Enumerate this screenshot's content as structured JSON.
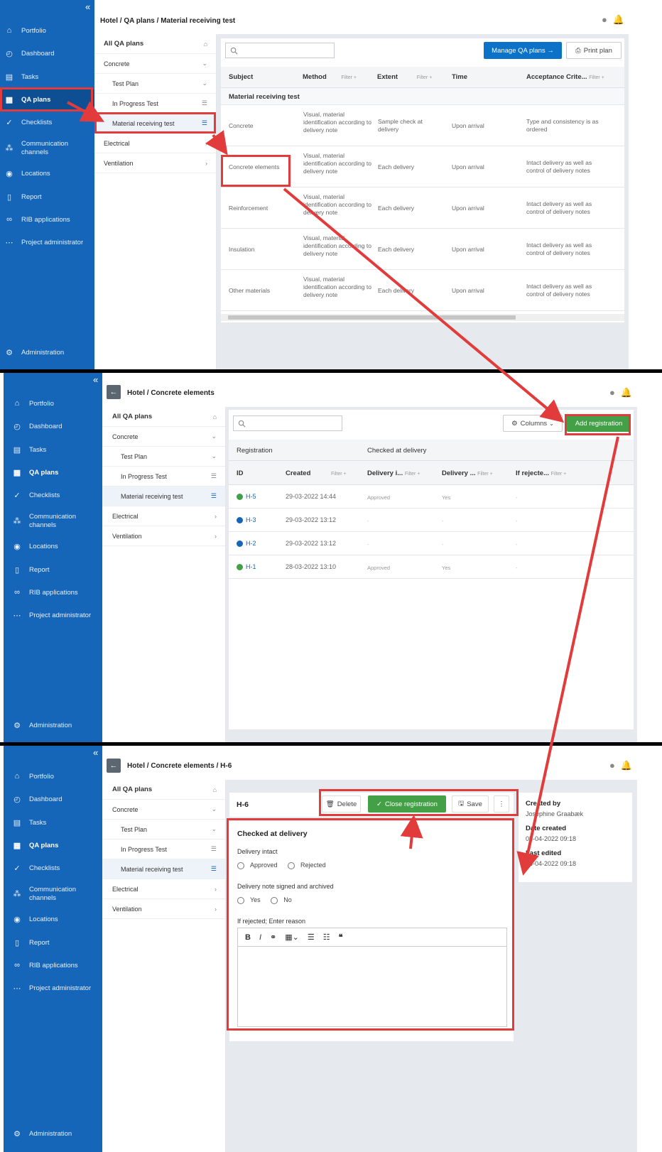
{
  "sidebar": {
    "items": [
      "Portfolio",
      "Dashboard",
      "Tasks",
      "QA plans",
      "Checklists",
      "Communication channels",
      "Locations",
      "Report",
      "RIB applications",
      "Project administrator"
    ],
    "admin": "Administration",
    "collapse": "«"
  },
  "nav": {
    "items": [
      "All QA plans",
      "Concrete",
      "Test Plan",
      "In Progress Test",
      "Material receiving test",
      "Electrical",
      "Ventilation"
    ]
  },
  "panel1": {
    "breadcrumb": "Hotel /  QA plans / Material receiving test",
    "manage_btn": "Manage QA plans →",
    "print_btn": "Print plan",
    "columns": [
      "Subject",
      "Method",
      "Extent",
      "Time",
      "Acceptance Crite..."
    ],
    "filter": "Filter +",
    "group": "Material receiving test",
    "rows": [
      {
        "subject": "Concrete",
        "method": "Visual, material identification according to delivery note",
        "extent": "Sample check at delivery",
        "time": "Upon arrival",
        "acceptance": "Type and consistency is as ordered"
      },
      {
        "subject": "Concrete elements",
        "method": "Visual, material identification according to delivery note",
        "extent": "Each delivery",
        "time": "Upon arrival",
        "acceptance": "Intact delivery as well as control of delivery notes"
      },
      {
        "subject": "Reinforcement",
        "method": "Visual, material identification according to delivery note",
        "extent": "Each delivery",
        "time": "Upon arrival",
        "acceptance": "Intact delivery as well as control of delivery notes"
      },
      {
        "subject": "Insulation",
        "method": "Visual, material identification according to delivery note",
        "extent": "Each delivery",
        "time": "Upon arrival",
        "acceptance": "Intact delivery as well as control of delivery notes"
      },
      {
        "subject": "Other materials",
        "method": "Visual, material identification according to delivery note",
        "extent": "Each delivery",
        "time": "Upon arrival",
        "acceptance": "Intact delivery as well as control of delivery notes"
      }
    ]
  },
  "panel2": {
    "breadcrumb": "Hotel / Concrete elements",
    "columns_btn": "Columns",
    "add_btn": "Add registration",
    "group_headers": [
      "Registration",
      "Checked at delivery"
    ],
    "columns": [
      "ID",
      "Created",
      "Delivery i...",
      "Delivery ...",
      "If rejecte..."
    ],
    "filter": "Filter +",
    "rows": [
      {
        "id": "H-5",
        "status": "green",
        "created": "29-03-2022 14:44",
        "intact": "Approved",
        "note": "Yes",
        "reason": "-"
      },
      {
        "id": "H-3",
        "status": "blue",
        "created": "29-03-2022 13:12",
        "intact": "-",
        "note": "-",
        "reason": "-"
      },
      {
        "id": "H-2",
        "status": "blue",
        "created": "29-03-2022 13:12",
        "intact": "-",
        "note": "-",
        "reason": "-"
      },
      {
        "id": "H-1",
        "status": "green",
        "created": "28-03-2022 13:10",
        "intact": "Approved",
        "note": "Yes",
        "reason": "-"
      }
    ]
  },
  "panel3": {
    "breadcrumb": "Hotel /  Concrete elements / H-6",
    "title": "H-6",
    "delete_btn": "Delete",
    "close_btn": "Close registration",
    "save_btn": "Save",
    "more": "⋮",
    "section": "Checked at delivery",
    "q1": "Delivery intact",
    "q1_opts": [
      "Approved",
      "Rejected"
    ],
    "q2": "Delivery note signed and archived",
    "q2_opts": [
      "Yes",
      "No"
    ],
    "q3": "If rejected; Enter reason",
    "meta": {
      "created_by_label": "Created by",
      "created_by": "Josephine Graabæk",
      "date_created_label": "Date created",
      "date_created": "05-04-2022 09:18",
      "last_edited_label": "Last edited",
      "last_edited": "05-04-2022 09:18"
    }
  },
  "colors": {
    "sidebar": "#1566b8",
    "accent": "#0b72c7",
    "green": "#43a047",
    "red": "#e23b3b"
  }
}
